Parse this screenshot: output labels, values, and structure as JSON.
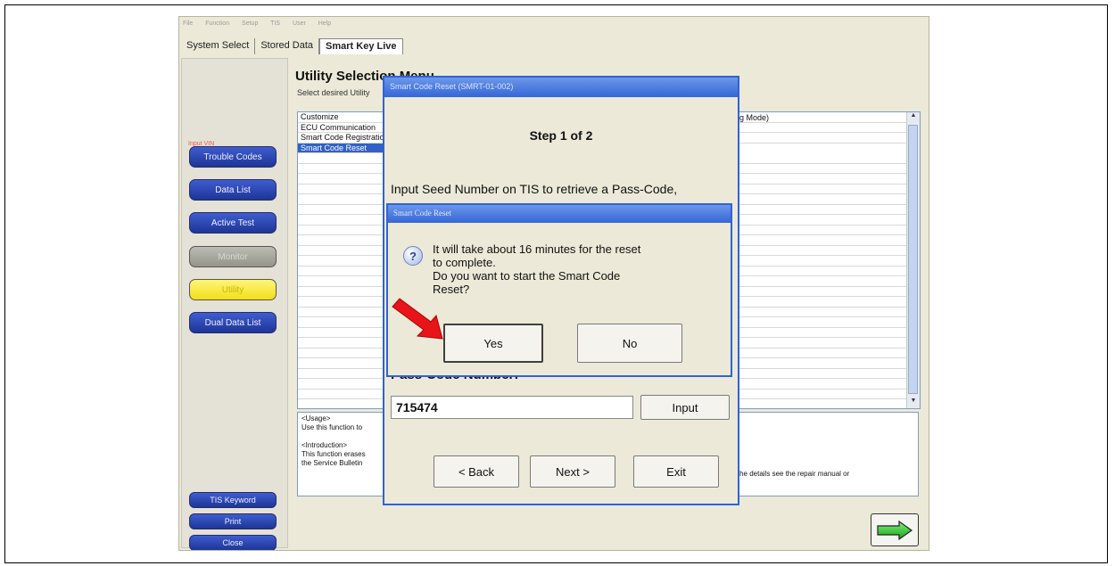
{
  "menubar": [
    "File",
    "Function",
    "Setup",
    "TIS",
    "User",
    "Help"
  ],
  "tabs": [
    "System Select",
    "Stored Data",
    "Smart Key Live"
  ],
  "sidebar": {
    "vin_label": "Input VIN",
    "buttons": [
      "Trouble Codes",
      "Data List",
      "Active Test",
      "Monitor",
      "Utility",
      "Dual Data List"
    ],
    "bottom_buttons": [
      "TIS Keyword",
      "Print",
      "Close"
    ]
  },
  "main": {
    "title": "Utility Selection Menu",
    "subtitle": "Select desired Utility",
    "list_items": [
      "Customize",
      "ECU Communication",
      "Smart Code Registration",
      "Smart Code Reset"
    ],
    "mode_text": "g Mode)",
    "usage_head": "<Usage>",
    "usage_line": "Use this function to",
    "intro_head": "<Introduction>",
    "intro_line1": "This function erases",
    "intro_line2": "the Service Bulletin",
    "intro_tail": "r the details see the repair manual or"
  },
  "dialog_reset": {
    "title": "Smart Code Reset (SMRT-01-002)",
    "step": "Step 1 of 2",
    "instruction": "Input Seed Number on TIS to retrieve a Pass-Code,",
    "pass_label": "Pass-Code Number:",
    "pass_value": "715474",
    "input_button": "Input",
    "back_button": "< Back",
    "next_button": "Next >",
    "exit_button": "Exit"
  },
  "dialog_confirm": {
    "title": "Smart Code Reset",
    "message_lines": [
      "It will take about 16 minutes for the reset",
      "to complete.",
      "Do you want to start the Smart Code",
      "Reset?"
    ],
    "yes_button": "Yes",
    "no_button": "No"
  },
  "colors": {
    "accent": "#2f63d6",
    "arrow": "#e8141a"
  }
}
